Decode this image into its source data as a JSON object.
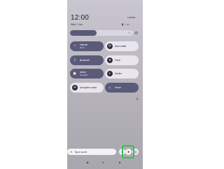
{
  "status": {
    "time": "12:00",
    "carrier": "Leaves",
    "date": "Wed 1 Jan",
    "icons": [
      "signal-icon",
      "wifi-icon",
      "battery-icon"
    ]
  },
  "brightness": {
    "level": 0.42
  },
  "tiles": [
    {
      "title": "Internet",
      "subtitle": "Wi-Fi",
      "icon": "wifi-icon",
      "state": "on"
    },
    {
      "title": "Auto-rotate",
      "subtitle": "",
      "icon": "rotate-icon",
      "state": "off"
    },
    {
      "title": "Bluetooth",
      "subtitle": "",
      "icon": "bluetooth-icon",
      "state": "on"
    },
    {
      "title": "Torch",
      "subtitle": "",
      "icon": "flashlight-icon",
      "state": "off"
    },
    {
      "title": "Alarm",
      "subtitle": "No alarm",
      "icon": "alarm-icon",
      "state": "on"
    },
    {
      "title": "Modes",
      "subtitle": "",
      "icon": "modes-icon",
      "state": "off"
    },
    {
      "title": "Aeroplane mode",
      "subtitle": "",
      "icon": "airplane-icon",
      "state": "off"
    },
    {
      "title": "Home",
      "subtitle": "",
      "icon": "home-icon",
      "state": "on"
    }
  ],
  "bottom": {
    "search_label": "Tap to scroll",
    "icon": "record-icon"
  },
  "colors": {
    "tile_on": "#5a5a7a",
    "tile_off": "#e8e6ec",
    "highlight": "#36c24a"
  }
}
